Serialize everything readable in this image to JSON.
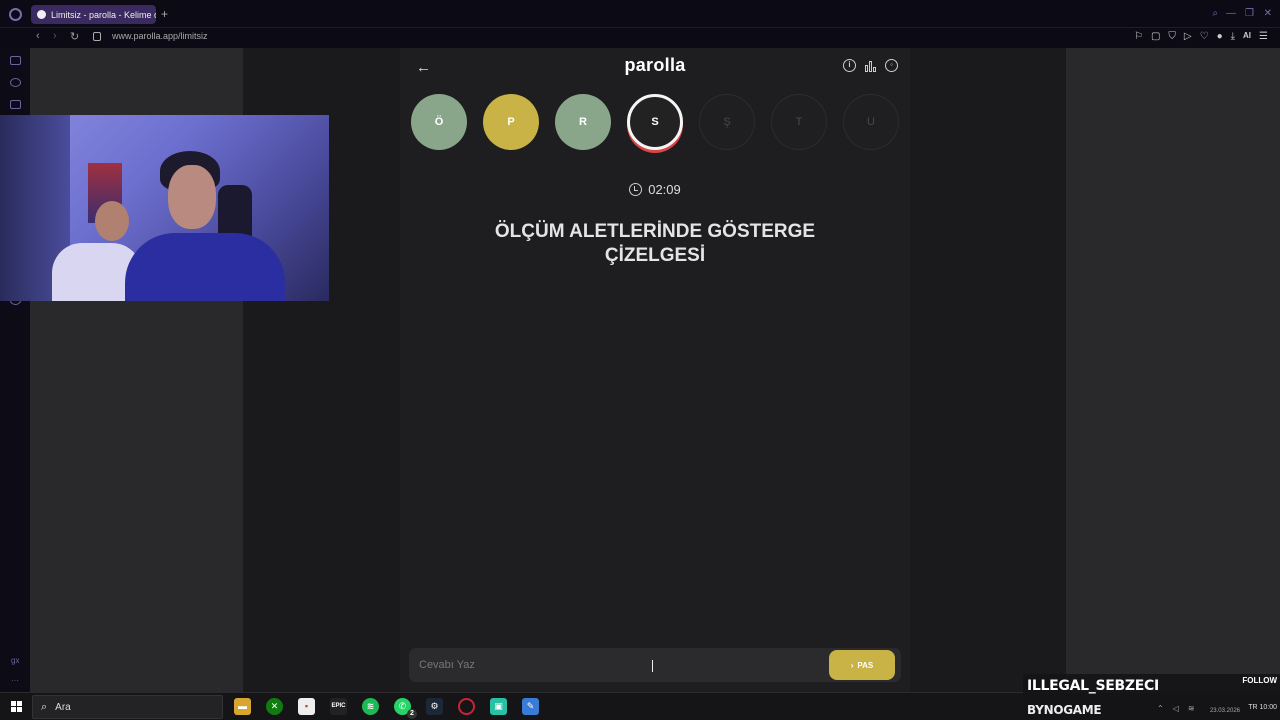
{
  "browser": {
    "tab_title": "Limitsiz - parolla - Kelime o",
    "url": "www.parolla.app/limitsiz",
    "ai_label": "AI"
  },
  "game": {
    "logo": "parolla",
    "letters": [
      {
        "letter": "Ö",
        "state": "correct"
      },
      {
        "letter": "P",
        "state": "passed"
      },
      {
        "letter": "R",
        "state": "correct"
      },
      {
        "letter": "S",
        "state": "active"
      },
      {
        "letter": "Ş",
        "state": "pending"
      },
      {
        "letter": "T",
        "state": "pending"
      },
      {
        "letter": "U",
        "state": "pending"
      }
    ],
    "timer": "02:09",
    "question": "ÖLÇÜM ALETLERİNDE GÖSTERGE ÇİZELGESİ",
    "answer_placeholder": "Cevabı Yaz",
    "pass_label": "PAS"
  },
  "taskbar": {
    "search_label": "Ara",
    "whatsapp_badge": "2"
  },
  "overlay": {
    "streamer_name": "ILLEGAL_SEBZECI",
    "follow_label": "FOLLOW",
    "channel": "BYNOGAME",
    "date": "23.03.2026",
    "time": "TR 10:00"
  },
  "colors": {
    "correct": "#8aa68a",
    "passed": "#c9b246",
    "accent_purple": "#3a2a60"
  }
}
